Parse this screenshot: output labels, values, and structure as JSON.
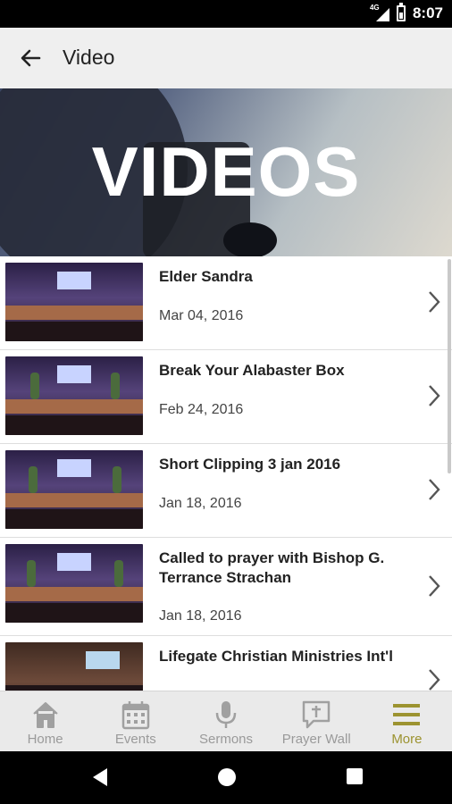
{
  "status_bar": {
    "time": "8:07",
    "network": "4G"
  },
  "app_bar": {
    "title": "Video"
  },
  "hero": {
    "title": "VIDEOS"
  },
  "videos": [
    {
      "title": "Elder Sandra",
      "date": "Mar 04, 2016"
    },
    {
      "title": "Break Your Alabaster Box",
      "date": "Feb 24, 2016"
    },
    {
      "title": "Short Clipping 3 jan 2016",
      "date": "Jan 18, 2016"
    },
    {
      "title": "Called to prayer with Bishop G. Terrance Strachan",
      "date": "Jan 18, 2016"
    },
    {
      "title": "Lifegate Christian Ministries Int'l",
      "date": ""
    }
  ],
  "bottom_nav": {
    "items": [
      {
        "label": "Home",
        "icon": "home-icon"
      },
      {
        "label": "Events",
        "icon": "calendar-icon"
      },
      {
        "label": "Sermons",
        "icon": "microphone-icon"
      },
      {
        "label": "Prayer Wall",
        "icon": "prayer-wall-icon"
      },
      {
        "label": "More",
        "icon": "menu-icon"
      }
    ],
    "active": "More",
    "active_color": "#9c9330",
    "inactive_color": "#9a9a9a"
  }
}
